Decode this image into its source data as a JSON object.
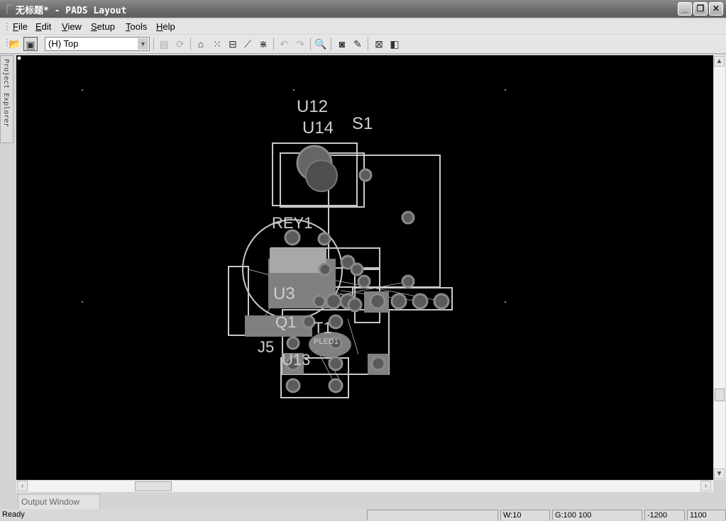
{
  "window": {
    "title": "无标题* - PADS Layout",
    "app_icon": "pads-icon",
    "controls": [
      "minimize",
      "restore",
      "close"
    ]
  },
  "menu": [
    "File",
    "Edit",
    "View",
    "Setup",
    "Tools",
    "Help"
  ],
  "toolbar": {
    "layer_select": "(H) Top",
    "icons": [
      "open-icon",
      "save-icon",
      "layer-select",
      "ecos-icon",
      "sync-icon",
      "drafting-icon",
      "bga-icon",
      "dimension-icon",
      "route-icon",
      "design-verify-icon",
      "undo-icon",
      "redo-icon",
      "zoom-icon",
      "view-icon",
      "paint-icon",
      "layout-icon",
      "window-icon"
    ]
  },
  "explorer_tab": "Project Explorer",
  "pcb": {
    "labels": {
      "u12": "U12",
      "u14": "U14",
      "s1": "S1",
      "rey1": "REY1",
      "u3": "U3",
      "q1": "Q1",
      "t1": "T1",
      "pled1": "PLED1",
      "j5": "J5",
      "u13": "U13"
    },
    "colors": {
      "background": "#000000",
      "outline": "#c8c8c8",
      "pad": "#5a5a5a",
      "pad_ring": "#8a8a8a",
      "copper": "#7e7e7e"
    }
  },
  "output_tab": "Output Window",
  "status": {
    "text": "Ready",
    "message": "",
    "width": "W:10",
    "grid": "G:100 100",
    "x": "-1200",
    "y": "1100"
  }
}
